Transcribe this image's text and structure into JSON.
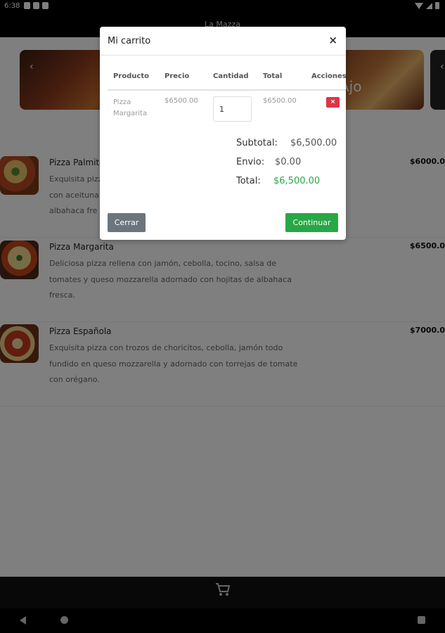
{
  "status_bar": {
    "time": "6:38"
  },
  "app": {
    "title": "La Mazza"
  },
  "carousel": {
    "visible_text": "Ajo",
    "prev_arrow": "‹"
  },
  "menu": [
    {
      "name": "Pizza Palmito",
      "desc_lines": [
        "Exquisita pizz",
        "con aceituna",
        "albahaca fre"
      ],
      "price": "$6000.0"
    },
    {
      "name": "Pizza Margarita",
      "desc_lines": [
        "Deliciosa pizza rellena con jamón, cebolla, tocino, salsa de",
        "tomates y queso mozzarella adornado con hojitas de albahaca",
        "fresca."
      ],
      "price": "$6500.0"
    },
    {
      "name": "Pizza Española",
      "desc_lines": [
        "Exquisita pizza con trozos de choricitos, cebolla, jamón todo",
        "fundido en queso mozzarella y adornado con torrejas de tomate",
        "con orégano."
      ],
      "price": "$7000.0"
    }
  ],
  "modal": {
    "title": "Mi carrito",
    "close_label": "×",
    "columns": [
      "Producto",
      "Precio",
      "Cantidad",
      "Total",
      "Acciones"
    ],
    "row": {
      "product_line1": "Pizza",
      "product_line2": "Margarita",
      "price": "$6500.00",
      "quantity": "1",
      "total": "$6500.00",
      "delete_label": "×"
    },
    "subtotal_label": "Subtotal:",
    "subtotal_value": "$6,500.00",
    "shipping_label": "Envio:",
    "shipping_value": "$0.00",
    "total_label": "Total:",
    "total_value": "$6,500.00",
    "close_button": "Cerrar",
    "continue_button": "Continuar"
  },
  "colors": {
    "success": "#28a745",
    "danger": "#dc3545",
    "secondary": "#6c757d"
  }
}
